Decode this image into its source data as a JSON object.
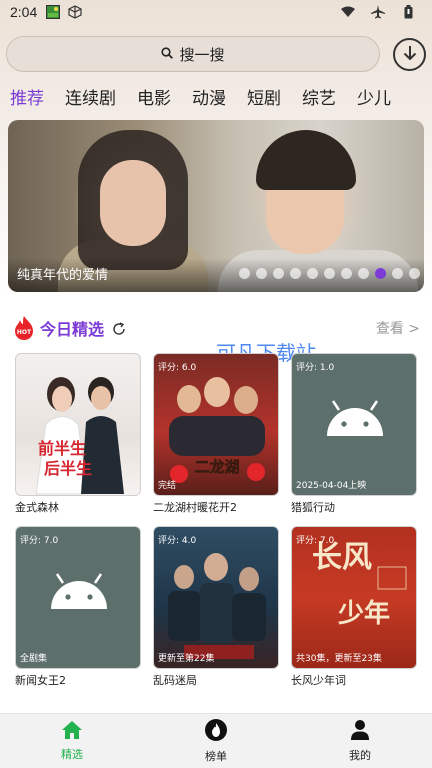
{
  "status_bar": {
    "time": "2:04",
    "icons_left": [
      "image-icon",
      "cube-icon"
    ],
    "icons_right": [
      "wifi-icon",
      "airplane-icon",
      "battery-icon"
    ]
  },
  "search": {
    "placeholder": "搜一搜"
  },
  "tabs": [
    {
      "label": "推荐",
      "active": true
    },
    {
      "label": "连续剧",
      "active": false
    },
    {
      "label": "电影",
      "active": false
    },
    {
      "label": "动漫",
      "active": false
    },
    {
      "label": "短剧",
      "active": false
    },
    {
      "label": "综艺",
      "active": false
    },
    {
      "label": "少儿",
      "active": false
    }
  ],
  "banner": {
    "caption": "纯真年代的爱情",
    "dot_count": 11,
    "active_dot": 8
  },
  "section": {
    "hot_badge": "HOT",
    "title": "今日精选",
    "see_more": "查看 >"
  },
  "watermark": "可凡下载站",
  "cards": [
    {
      "title": "金式森林",
      "top": "",
      "bottom": "",
      "poster": "wedding"
    },
    {
      "title": "二龙湖村暖花开2",
      "top": "评分: 6.0",
      "bottom": "完结",
      "poster": "comedy"
    },
    {
      "title": "猎狐行动",
      "top": "评分: 1.0",
      "bottom": "2025-04-04上映",
      "poster": "android"
    },
    {
      "title": "新闻女王2",
      "top": "评分: 7.0",
      "bottom": "全剧集",
      "poster": "android"
    },
    {
      "title": "乱码迷局",
      "top": "评分: 4.0",
      "bottom": "更新至第22集",
      "poster": "thriller"
    },
    {
      "title": "长风少年词",
      "top": "评分: 7.0",
      "bottom": "共30集，更新至23集",
      "poster": "red"
    }
  ],
  "bottom_nav": [
    {
      "label": "精选",
      "icon": "home-icon",
      "active": true
    },
    {
      "label": "榜单",
      "icon": "flame-icon",
      "active": false
    },
    {
      "label": "我的",
      "icon": "user-icon",
      "active": false
    }
  ],
  "colors": {
    "accent": "#7c3bd6",
    "nav_active": "#22b14c",
    "watermark": "#3b7cf0"
  }
}
